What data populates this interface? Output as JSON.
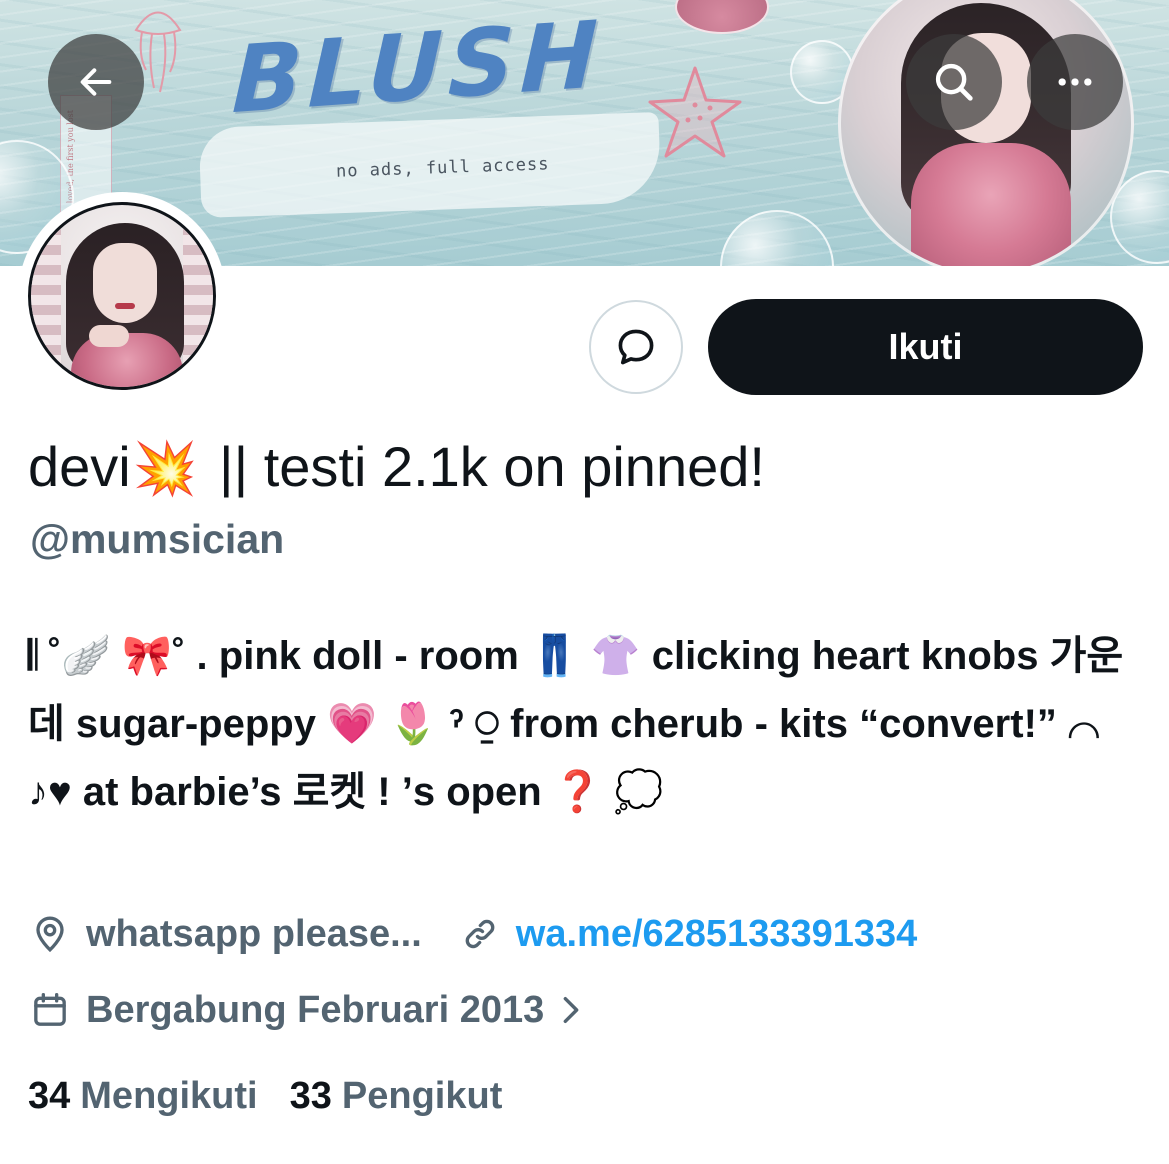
{
  "banner": {
    "title": "BLUSH",
    "tagline": "no ads, full access",
    "side_card_text": "the first you loved, the first you lost"
  },
  "nav": {
    "back_icon": "arrow-left-icon",
    "search_icon": "search-icon",
    "more_icon": "more-horizontal-icon"
  },
  "profile": {
    "display_name": "devi",
    "display_name_emoji": "💥",
    "display_name_suffix": " || testi 2.1k on pinned!",
    "handle": "@mumsician",
    "bio": "𝄃 ˚🪽 🎀˚ . pink doll - room 👖 👚 clicking heart knobs 가운데 sugar-peppy 💗 🌷 ˀ ⍜ from cherub - kits “convert!” ⌒ ♪♥ at barbie’s 로켓 ! ’s open ❓ 💭",
    "location": "whatsapp please...",
    "website": "wa.me/6285133391334",
    "joined": "Bergabung Februari 2013",
    "following_count": "34",
    "following_label": "Mengikuti",
    "followers_count": "33",
    "followers_label": "Pengikut"
  },
  "actions": {
    "message_icon": "message-bubble-icon",
    "follow_label": "Ikuti"
  },
  "colors": {
    "primary_text": "#0f1419",
    "secondary_text": "#536471",
    "link": "#1d9bf0",
    "follow_button_bg": "#0f1419"
  }
}
